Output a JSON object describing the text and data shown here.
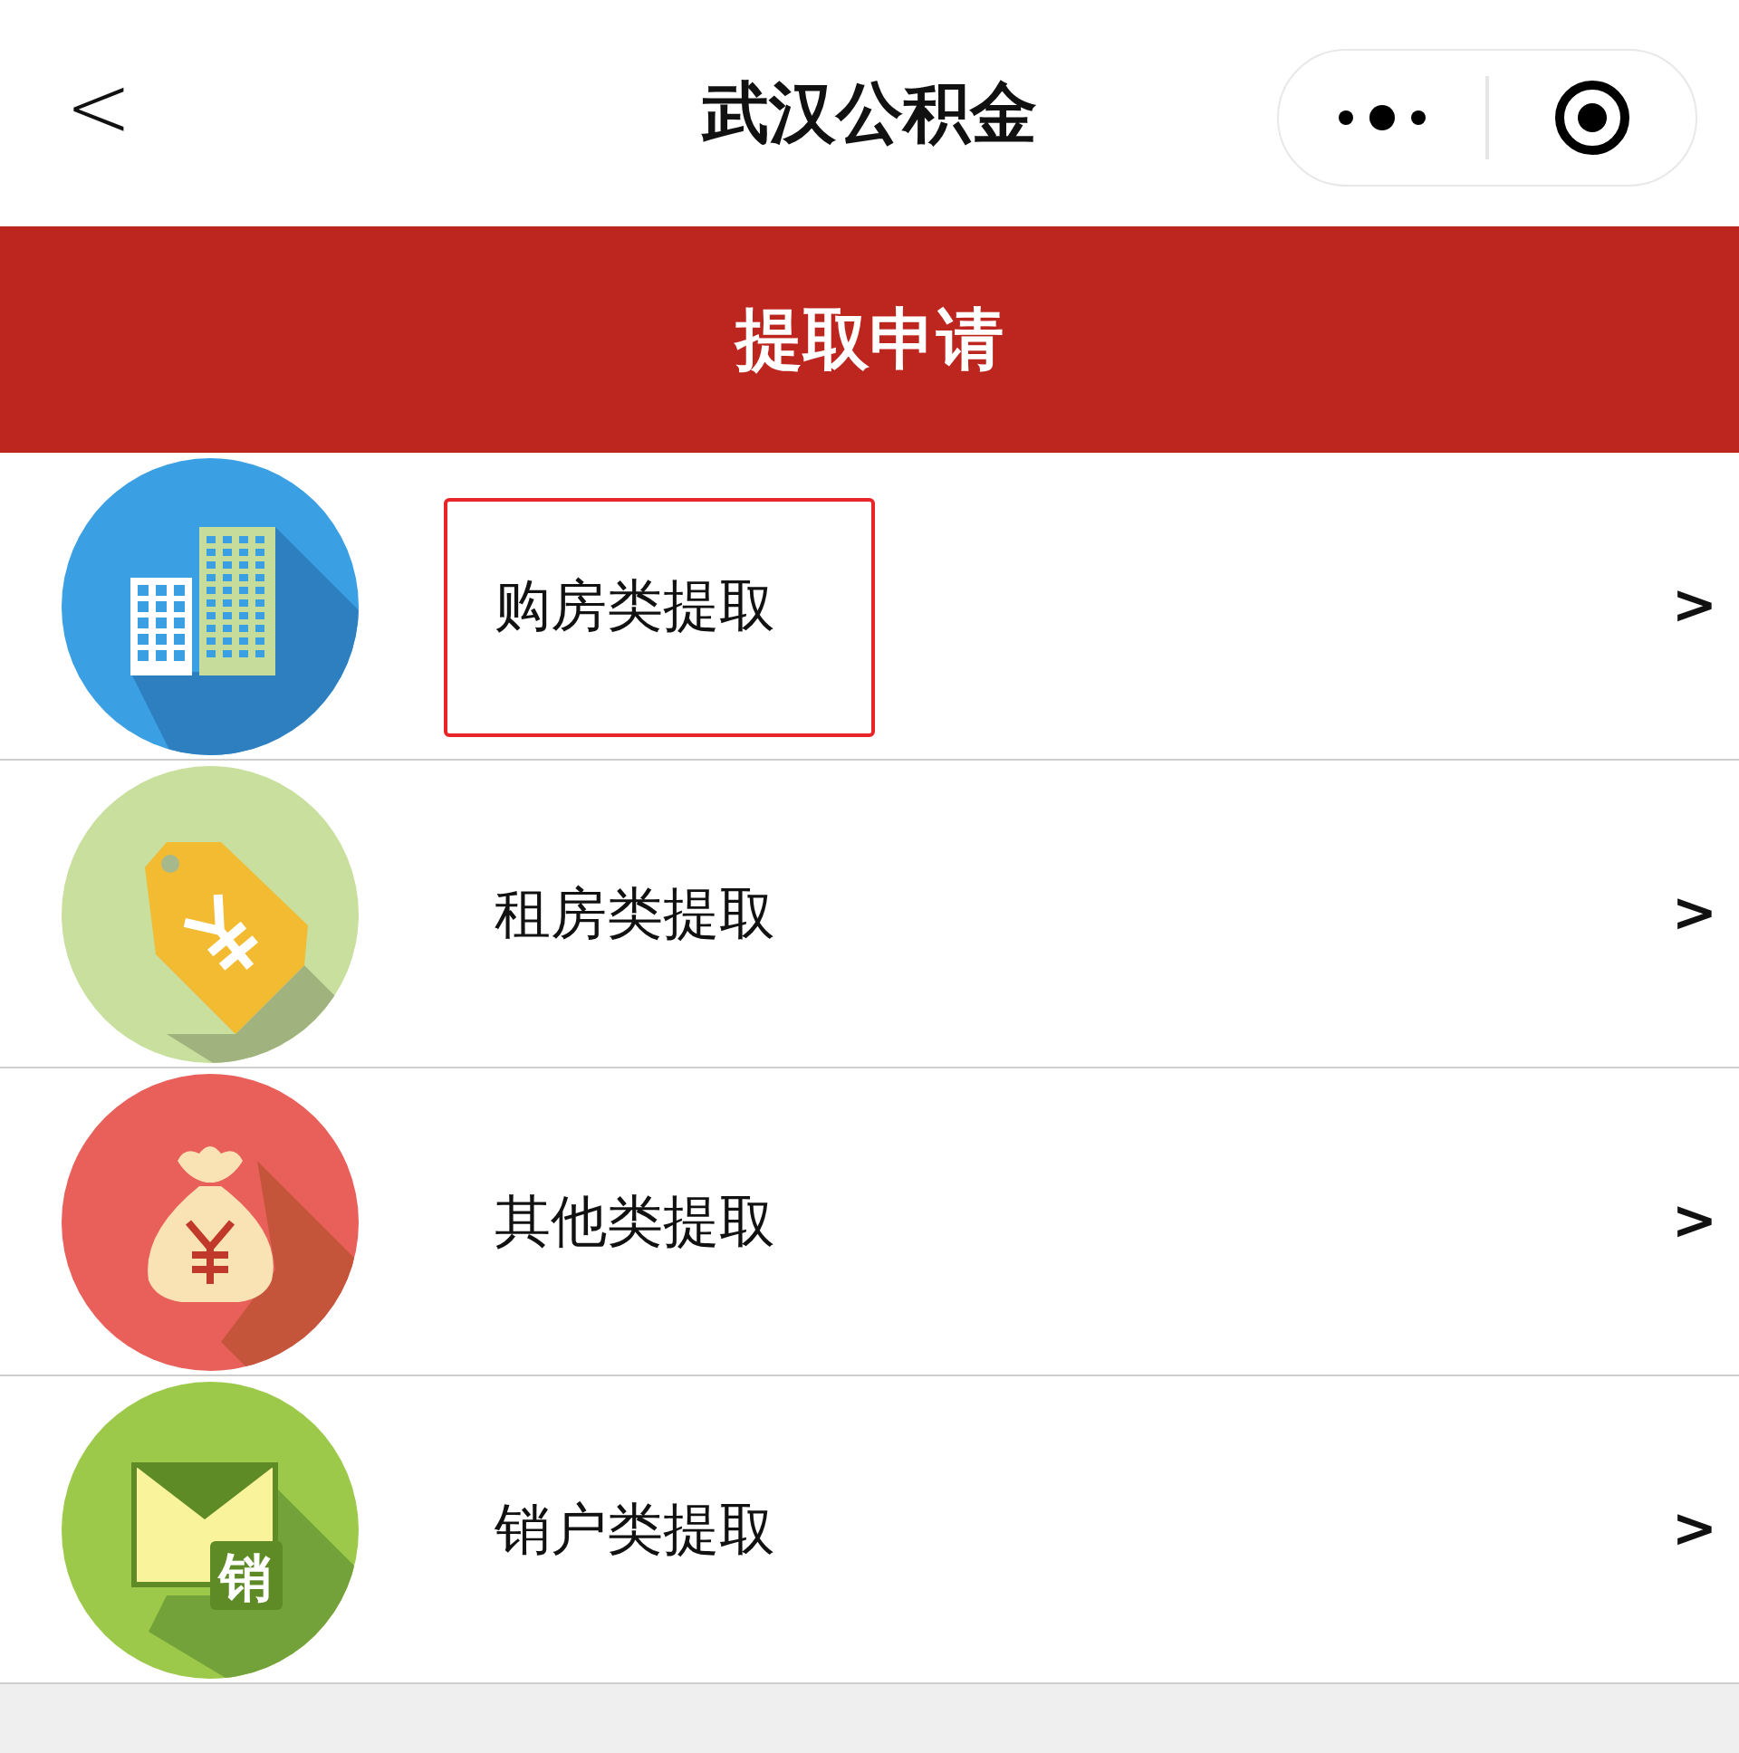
{
  "nav_bar": {
    "back": "<",
    "title": "武汉公积金"
  },
  "banner": {
    "title": "提取申请"
  },
  "items": [
    {
      "kind": "buildings",
      "label": "购房类提取",
      "chevron": ">",
      "highlighted": true
    },
    {
      "kind": "tag",
      "label": "租房类提取",
      "chevron": ">",
      "highlighted": false
    },
    {
      "kind": "moneybag",
      "label": "其他类提取",
      "chevron": ">",
      "highlighted": false
    },
    {
      "kind": "envelope",
      "label": "销户类提取",
      "chevron": ">",
      "highlighted": false,
      "icon_text": "销"
    }
  ]
}
